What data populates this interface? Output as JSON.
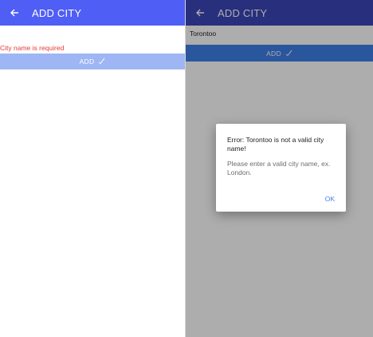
{
  "left_screen": {
    "appbar": {
      "title": "ADD CITY",
      "back_icon": "arrow-left-icon"
    },
    "error": "City name is required",
    "add_button": {
      "label": "ADD",
      "icon": "check-icon"
    }
  },
  "right_screen": {
    "appbar": {
      "title": "ADD CITY",
      "back_icon": "arrow-left-icon"
    },
    "city_input": {
      "value": "Torontoo"
    },
    "add_button": {
      "label": "ADD",
      "icon": "check-icon"
    },
    "dialog": {
      "title": "Error: Torontoo is not a valid city name!",
      "message": "Please enter a valid city name, ex. London.",
      "ok_label": "OK"
    }
  },
  "colors": {
    "appbar": "#4f5ef5",
    "error": "#e53935",
    "button_disabled": "#9fb6f5",
    "button": "#3f7fe8"
  }
}
